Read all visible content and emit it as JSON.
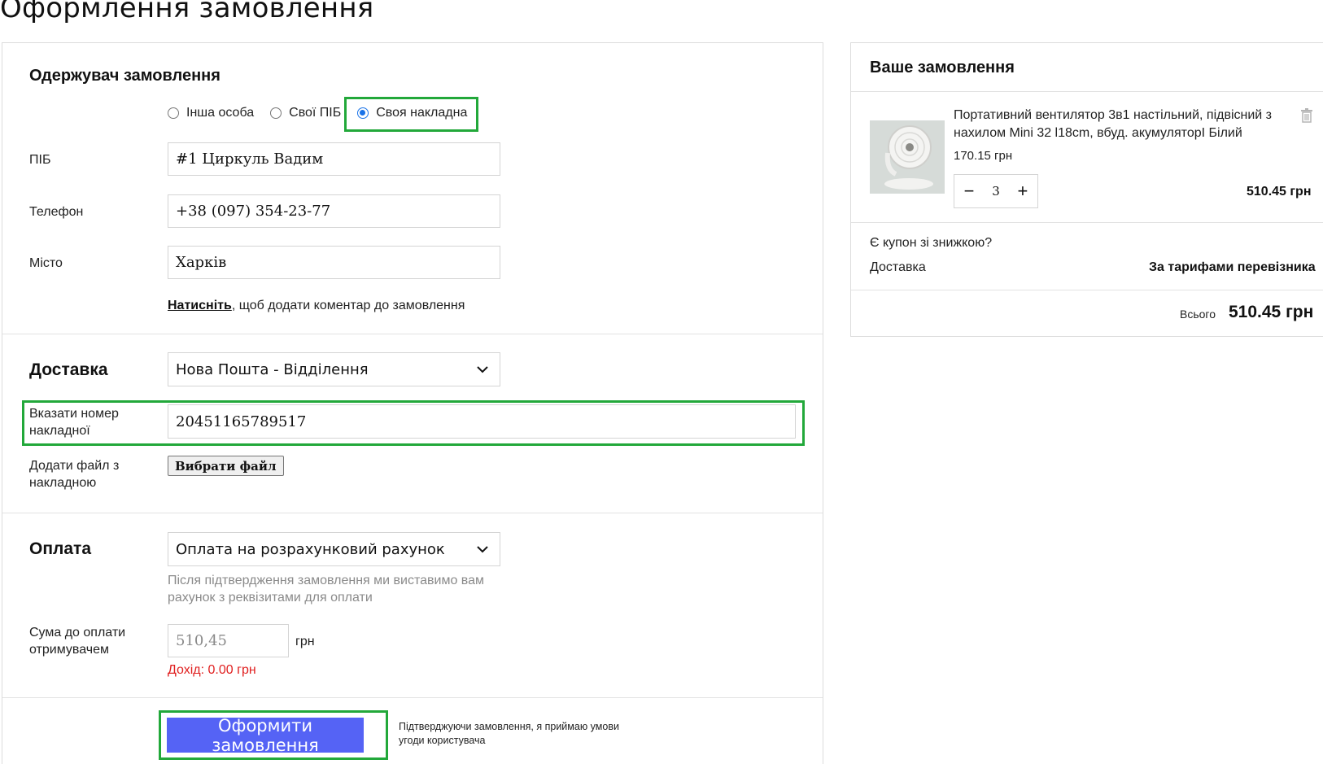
{
  "page_title": "Оформлення замовлення",
  "recipient": {
    "title": "Одержувач замовлення",
    "radio_options": [
      {
        "label": "Інша особа",
        "checked": false
      },
      {
        "label": "Свої ПІБ",
        "checked": false
      },
      {
        "label": "Своя накладна",
        "checked": true
      }
    ],
    "name_label": "ПІБ",
    "name_value": "#1 Циркуль Вадим",
    "phone_label": "Телефон",
    "phone_value": "+38 (097) 354-23-77",
    "city_label": "Місто",
    "city_value": "Харків",
    "comment_link": "Натисніть",
    "comment_text": ", щоб додати коментар до замовлення"
  },
  "delivery": {
    "title": "Доставка",
    "method": "Нова Пошта - Відділення",
    "waybill_label_line1": "Вказати номер",
    "waybill_label_line2": "накладної",
    "waybill_value": "20451165789517",
    "file_label_line1": "Додати файл з",
    "file_label_line2": "накладною",
    "file_button": "Вибрати файл"
  },
  "payment": {
    "title": "Оплата",
    "method": "Оплата на розрахунковий рахунок",
    "note_line1": "Після підтвердження замовлення ми виставимо вам",
    "note_line2": "рахунок з реквізитами для оплати",
    "amount_label_line1": "Сума до оплати",
    "amount_label_line2": "отримувачем",
    "amount_placeholder": "510,45",
    "currency": "грн",
    "income": "Дохід: 0.00 грн"
  },
  "submit": {
    "label": "Оформити замовлення",
    "terms_line1": "Підтверджуючи замовлення, я приймаю умови",
    "terms_line2": "угоди користувача"
  },
  "order": {
    "title": "Ваше замовлення",
    "product_name_line1": "Портативний вентилятор 3в1 настільний, підвісний з",
    "product_name_line2": "нахилом Mini 32 l18cm, вбуд. акумуляторІ Білий",
    "unit_price": "170.15 грн",
    "minus": "−",
    "plus": "+",
    "quantity": "3",
    "line_total": "510.45 грн",
    "coupon_text": "Є купон зі знижкою?",
    "shipping_label": "Доставка",
    "shipping_value": "За тарифами перевізника",
    "total_label": "Всього",
    "total_value": "510.45 грн"
  },
  "colors": {
    "accent": "#5563f5",
    "highlight": "#22a83a",
    "radio": "#1a73e8",
    "error": "#e02020"
  }
}
